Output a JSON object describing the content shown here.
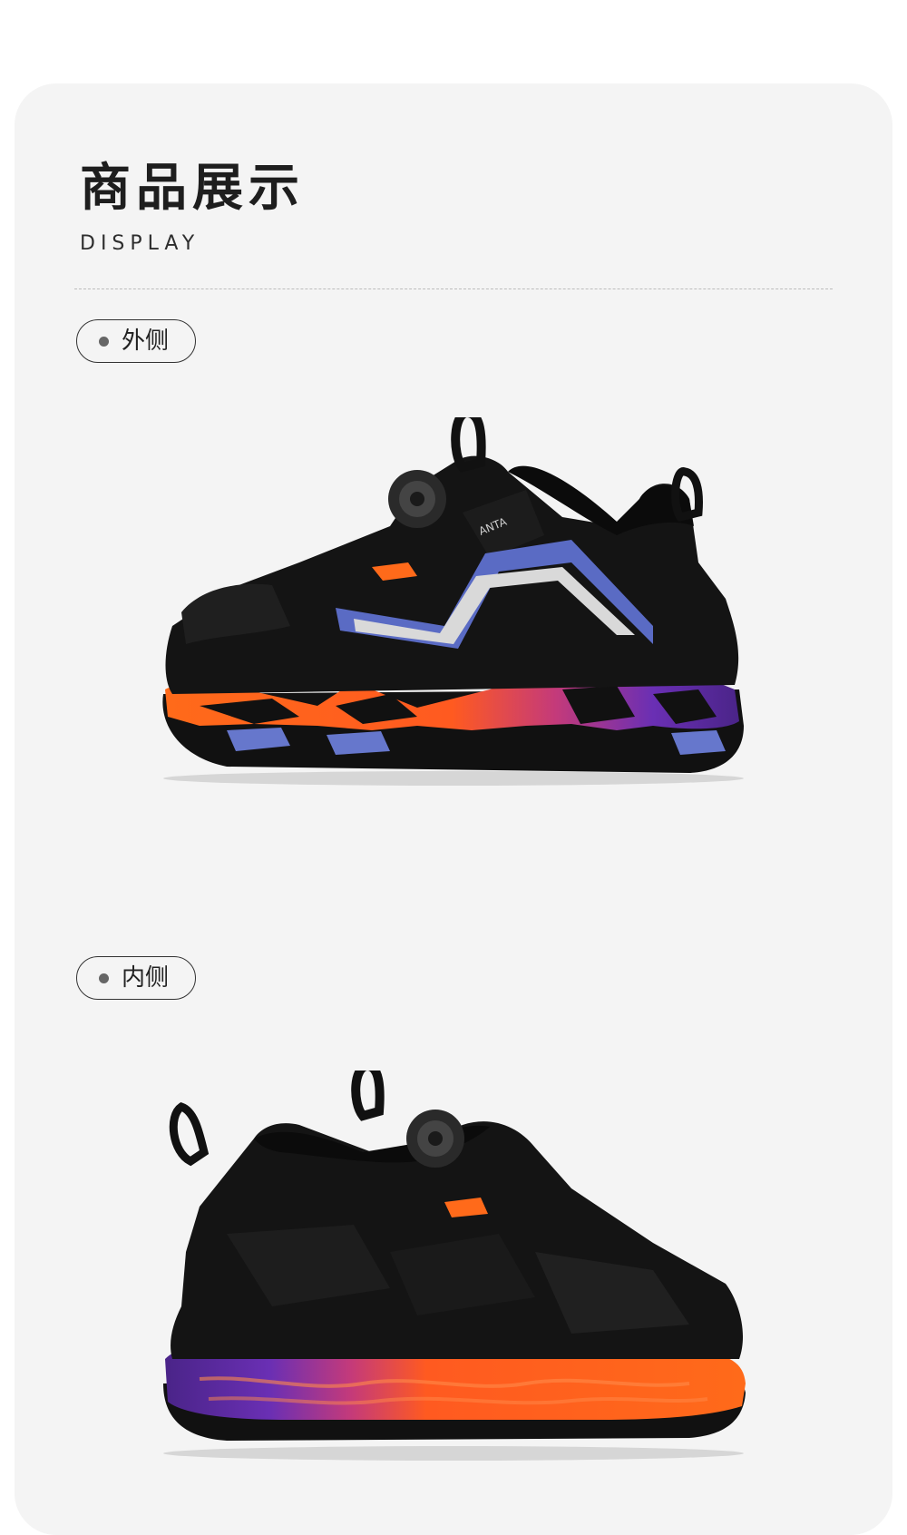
{
  "header": {
    "title": "商品展示",
    "subtitle": "DISPLAY"
  },
  "views": [
    {
      "label": "外侧",
      "image": "shoe-outer-side-image",
      "brand": "ANTA"
    },
    {
      "label": "内侧",
      "image": "shoe-inner-side-image"
    }
  ],
  "colors": {
    "background": "#f4f4f4",
    "upper": "#141414",
    "sole_orange": "#ff6a1a",
    "sole_purple": "#6a2fb4",
    "accent_blue": "#5a6bc4",
    "reflective": "#d9d9d9"
  }
}
